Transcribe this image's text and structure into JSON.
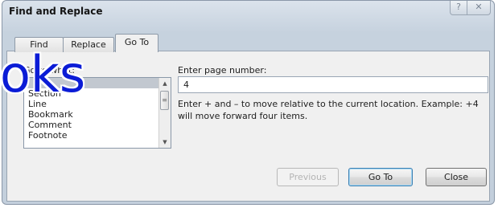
{
  "window": {
    "title": "Find and Replace",
    "help_glyph": "?",
    "close_glyph": "✕"
  },
  "tabs": [
    {
      "label": "Find",
      "active": false
    },
    {
      "label": "Replace",
      "active": false
    },
    {
      "label": "Go To",
      "active": true
    }
  ],
  "goto_what": {
    "label": "Go to what:",
    "items": [
      {
        "label": "Page",
        "selected": true
      },
      {
        "label": "Section",
        "selected": false
      },
      {
        "label": "Line",
        "selected": false
      },
      {
        "label": "Bookmark",
        "selected": false
      },
      {
        "label": "Comment",
        "selected": false
      },
      {
        "label": "Footnote",
        "selected": false
      }
    ]
  },
  "page_number": {
    "label": "Enter page number:",
    "value": "4",
    "hint": "Enter + and – to move relative to the current location. Example: +4 will move forward four items."
  },
  "buttons": {
    "previous": "Previous",
    "goto": "Go To",
    "close": "Close"
  },
  "watermark": {
    "text": "oks"
  }
}
